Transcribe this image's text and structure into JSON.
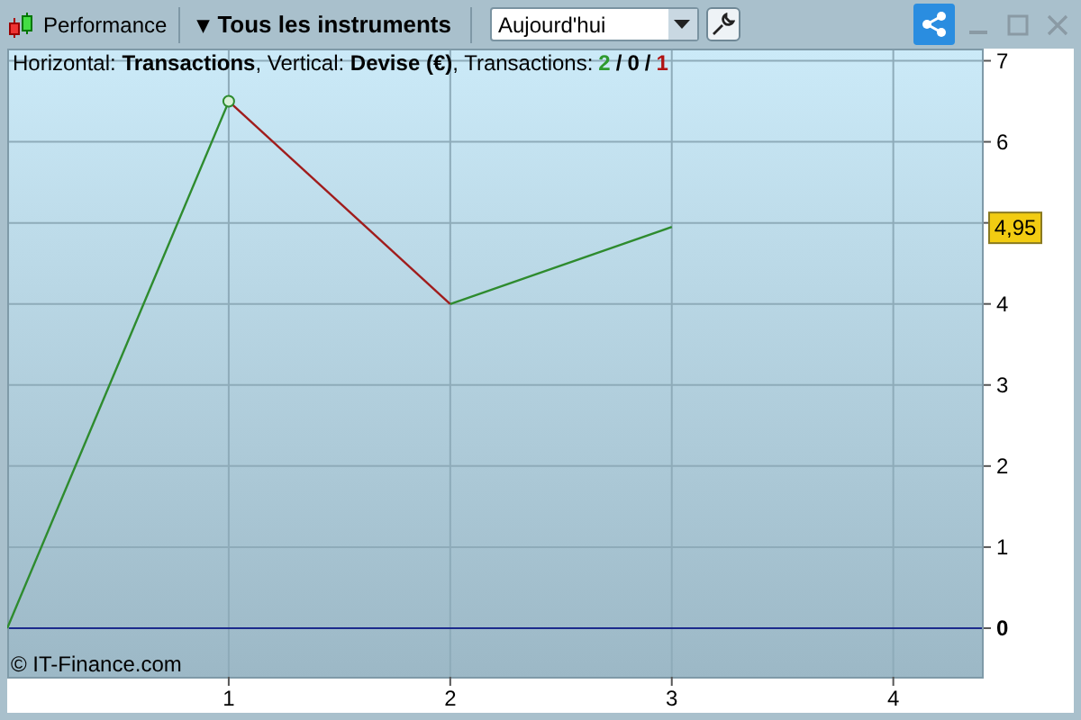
{
  "toolbar": {
    "title": "Performance",
    "instrument_menu": {
      "caret": "▾",
      "label": "Tous les instruments"
    },
    "period": {
      "value": "Aujourd'hui"
    }
  },
  "chart": {
    "info": "Horizontal: **Transactions**, Vertical: **Devise (€)**, Transactions:",
    "counts": [
      {
        "text": "2",
        "color": "#2e9a2e"
      },
      {
        "text": "0",
        "color": "#000000"
      },
      {
        "text": "1",
        "color": "#b01414"
      }
    ],
    "count_separator": "/",
    "copyright": "© IT-Finance.com",
    "last_value": "4,95",
    "chart_data": {
      "type": "line",
      "x": [
        0,
        1,
        2,
        3
      ],
      "series": [
        {
          "color": "#2e8b2e",
          "values": [
            0,
            6.5,
            null,
            null
          ]
        },
        {
          "color": "#a01c1c",
          "values": [
            null,
            6.5,
            4,
            null
          ]
        },
        {
          "color": "#2e8b2e",
          "values": [
            null,
            null,
            4,
            4.95
          ]
        }
      ],
      "ref_lines": [
        {
          "axis": "y",
          "value": 0,
          "color": "#1c2a8c"
        }
      ],
      "grid": true,
      "xlim": [
        0,
        4.4
      ],
      "ylim": [
        -0.6,
        7.15
      ],
      "xticks": [
        1,
        2,
        3,
        4
      ],
      "yticks": [
        0,
        1,
        2,
        3,
        4,
        6,
        7
      ]
    }
  }
}
